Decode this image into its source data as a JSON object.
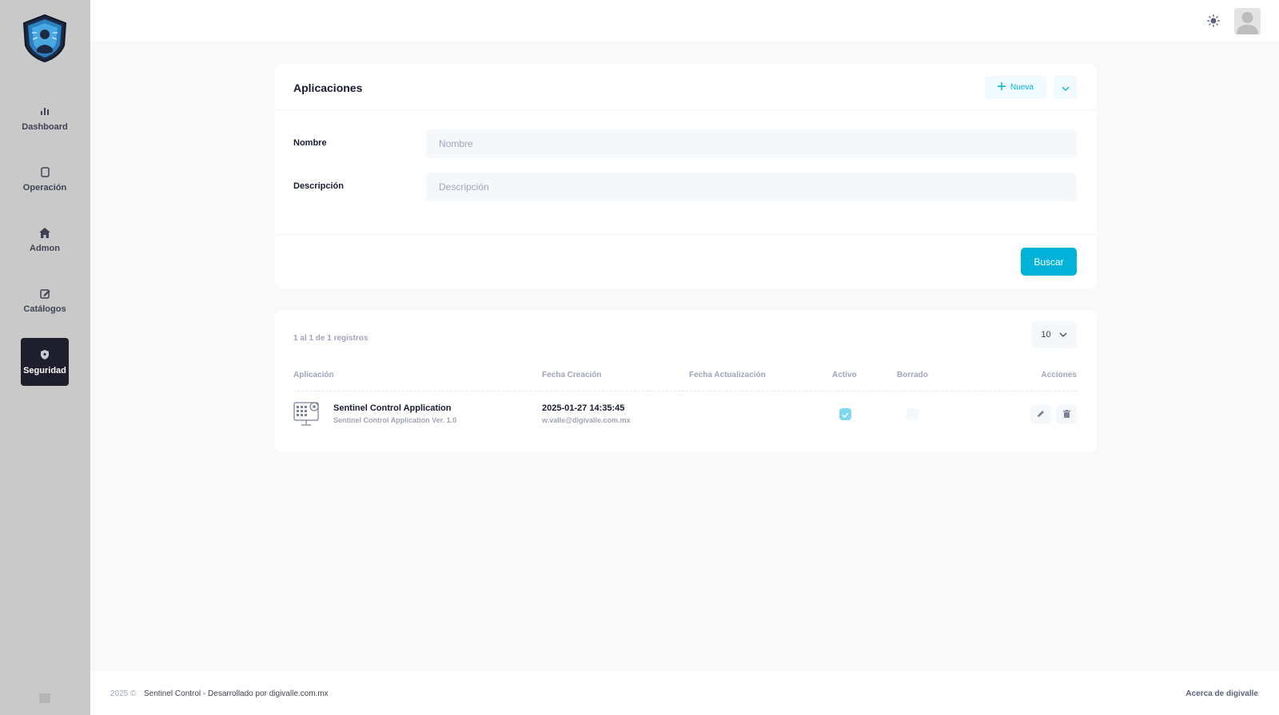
{
  "sidebar": {
    "items": [
      {
        "label": "Dashboard",
        "icon": "bar-chart-icon"
      },
      {
        "label": "Operación",
        "icon": "copy-icon"
      },
      {
        "label": "Admon",
        "icon": "home-icon"
      },
      {
        "label": "Catálogos",
        "icon": "edit-icon"
      },
      {
        "label": "Seguridad",
        "icon": "shield-icon",
        "active": true
      }
    ]
  },
  "search_card": {
    "title": "Aplicaciones",
    "new_label": "Nueva",
    "fields": {
      "nombre_label": "Nombre",
      "nombre_placeholder": "Nombre",
      "descripcion_label": "Descripción",
      "descripcion_placeholder": "Descripción"
    },
    "search_label": "Buscar"
  },
  "results": {
    "records_text": "1 al 1 de 1 registros",
    "page_size": "10",
    "columns": [
      "Aplicación",
      "Fecha Creación",
      "Fecha Actualización",
      "Activo",
      "Borrado",
      "Acciones"
    ],
    "rows": [
      {
        "name": "Sentinel Control Application",
        "description": "Sentinel Control Application Ver. 1.0",
        "created": "2025-01-27 14:35:45",
        "created_by": "w.valle@digivalle.com.mx",
        "updated": "",
        "active": true,
        "deleted": false
      }
    ]
  },
  "footer": {
    "year": "2025 ©",
    "text": "Sentinel Control - Desarrollado por digivalle.com.mx",
    "link": "Acerca de digivalle"
  },
  "colors": {
    "accent": "#00b2d8",
    "sidebar_bg": "#c9c9c9",
    "active_nav": "#1e1e2d"
  }
}
